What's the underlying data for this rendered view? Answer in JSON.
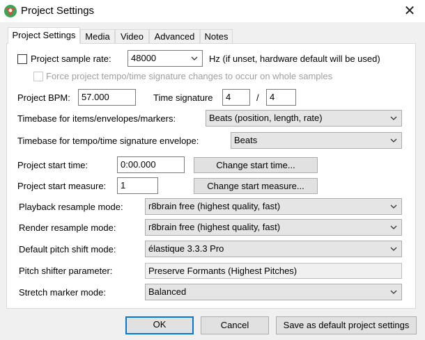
{
  "window": {
    "title": "Project Settings",
    "close_glyph": "✕",
    "icon": "reaper-logo-icon"
  },
  "tabs": [
    {
      "label": "Project Settings",
      "active": true
    },
    {
      "label": "Media",
      "active": false
    },
    {
      "label": "Video",
      "active": false
    },
    {
      "label": "Advanced",
      "active": false
    },
    {
      "label": "Notes",
      "active": false
    }
  ],
  "sample_rate": {
    "checkbox_label": "Project sample rate:",
    "checked": false,
    "value": "48000",
    "hint": "Hz (if unset, hardware default will be used)",
    "force_label": "Force project tempo/time signature changes to occur on whole samples"
  },
  "bpm": {
    "label": "Project BPM:",
    "value": "57.000"
  },
  "time_signature": {
    "label": "Time signature",
    "numerator": "4",
    "separator": "/",
    "denominator": "4"
  },
  "timebase_items": {
    "label": "Timebase for items/envelopes/markers:",
    "value": "Beats (position, length, rate)"
  },
  "timebase_tempo": {
    "label": "Timebase for tempo/time signature envelope:",
    "value": "Beats"
  },
  "start_time": {
    "label": "Project start time:",
    "value": "0:00.000",
    "button": "Change start time..."
  },
  "start_measure": {
    "label": "Project start measure:",
    "value": "1",
    "button": "Change start measure..."
  },
  "playback_resample": {
    "label": "Playback resample mode:",
    "value": "r8brain free (highest quality, fast)"
  },
  "render_resample": {
    "label": "Render resample mode:",
    "value": "r8brain free (highest quality, fast)"
  },
  "pitch_shift": {
    "label": "Default pitch shift mode:",
    "value": "élastique 3.3.3 Pro"
  },
  "pitch_param": {
    "label": "Pitch shifter parameter:",
    "value": "Preserve Formants (Highest Pitches)"
  },
  "stretch_marker": {
    "label": "Stretch marker mode:",
    "value": "Balanced"
  },
  "footer": {
    "ok": "OK",
    "cancel": "Cancel",
    "save_default": "Save as default project settings"
  },
  "colors": {
    "accent": "#0078d7",
    "panel": "#ffffff",
    "background": "#f0f0f0"
  }
}
